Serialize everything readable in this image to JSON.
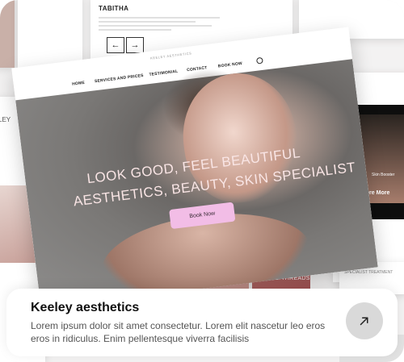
{
  "preview": {
    "testimonial": {
      "name": "TABITHA"
    },
    "nav": {
      "logo": "KEELEY AESTHETICS",
      "items": [
        "HOME",
        "SERVICES AND PRICES",
        "TESTIMONIAL",
        "CONTACT",
        "BOOK NOW"
      ]
    },
    "hero": {
      "headline_1": "LOOK GOOD, FEEL BEAUTIFUL",
      "headline_2": "AESTHETICS, BEAUTY, SKIN SPECIALIST",
      "cta": "Book Now"
    },
    "side": {
      "left_label": "LEY",
      "skin_label": "Skin Booster",
      "explore": "Explore More",
      "small_text": "SPECIALIST TREATMENT"
    },
    "thumbnails": {
      "third_label": "PDO THREADS"
    }
  },
  "card": {
    "title": "Keeley aesthetics",
    "description": "Lorem ipsum dolor sit amet consectetur. Lorem elit nascetur leo eros eros in ridiculus. Enim pellentesque viverra facilisis"
  },
  "colors": {
    "cta_pink": "#f2bde6",
    "arrow_button": "#d9d9d9",
    "title_text": "#111111",
    "description_text": "#555555"
  },
  "icons": {
    "open": "arrow-up-right-icon"
  }
}
